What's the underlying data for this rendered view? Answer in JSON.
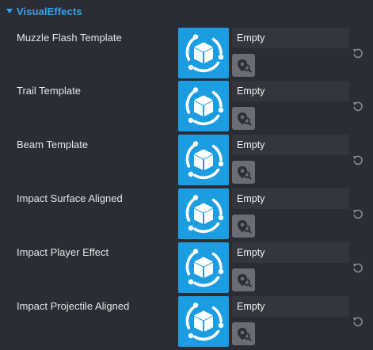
{
  "section": {
    "title": "VisualEffects"
  },
  "properties": [
    {
      "label": "Muzzle Flash Template",
      "value": "Empty"
    },
    {
      "label": "Trail Template",
      "value": "Empty"
    },
    {
      "label": "Beam Template",
      "value": "Empty"
    },
    {
      "label": "Impact Surface Aligned",
      "value": "Empty"
    },
    {
      "label": "Impact Player Effect",
      "value": "Empty"
    },
    {
      "label": "Impact Projectile Aligned",
      "value": "Empty"
    }
  ],
  "icons": {
    "section_toggle": "triangle-down-icon",
    "thumbnail": "template-cube-icon",
    "picker": "asset-picker-icon",
    "reset": "reset-icon"
  },
  "colors": {
    "background": "#2a2d35",
    "accent": "#3ba3ea",
    "thumbnail_bg": "#1c9de2",
    "field_bg": "#33363e",
    "picker_bg": "#6a6d73"
  }
}
